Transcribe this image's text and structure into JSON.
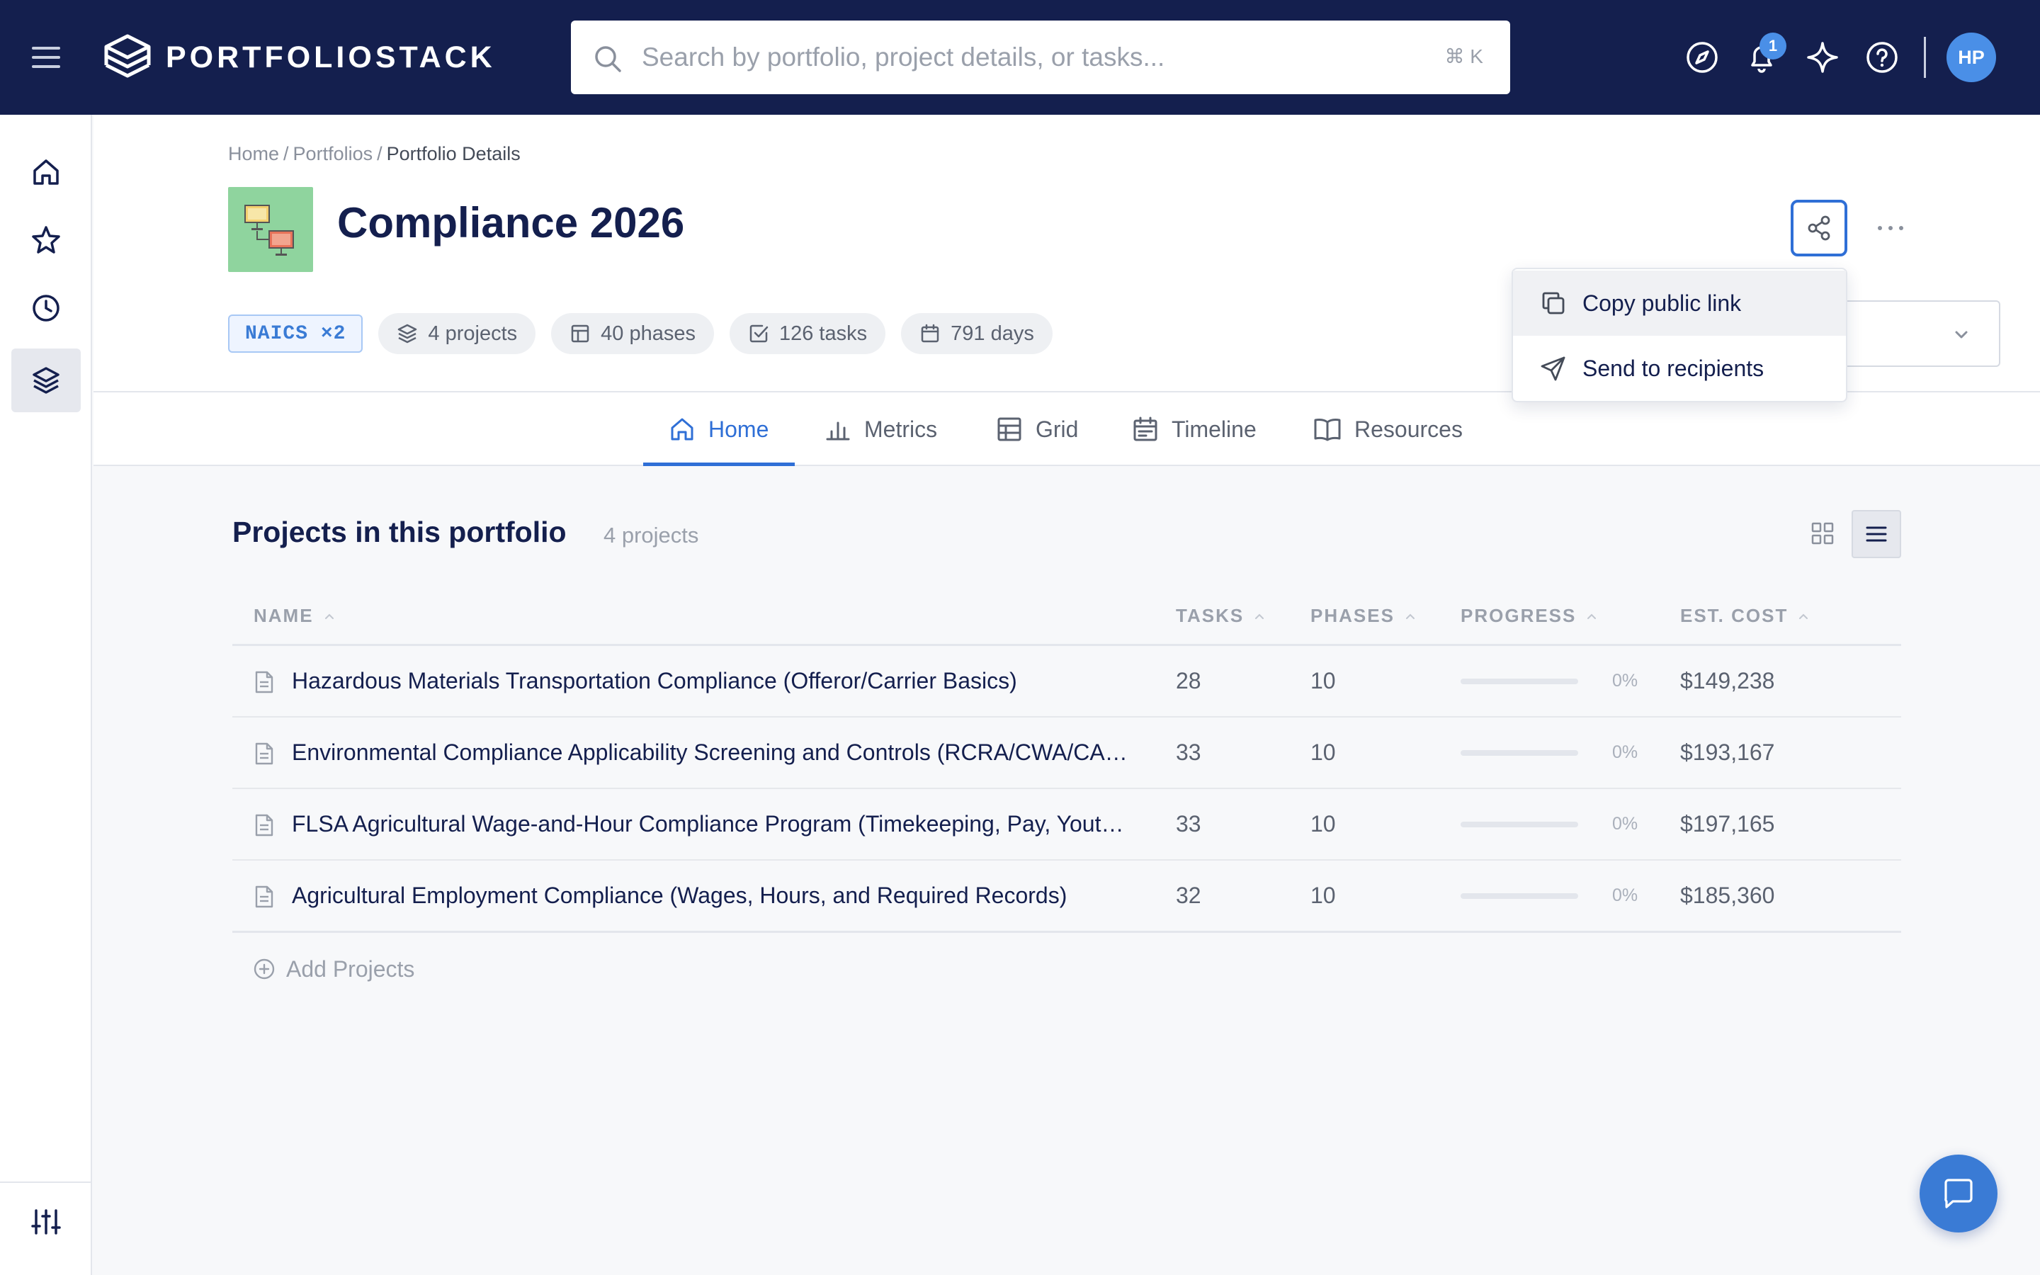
{
  "app": {
    "logo_text": "PORTFOLIOSTACK"
  },
  "search": {
    "placeholder": "Search by portfolio, project details, or tasks...",
    "shortcut": "⌘ K"
  },
  "topbar": {
    "notification_count": "1",
    "user_initials": "HP"
  },
  "breadcrumb": {
    "home": "Home",
    "portfolios": "Portfolios",
    "current": "Portfolio Details",
    "sep": "/"
  },
  "portfolio": {
    "title": "Compliance 2026",
    "naics_tag": "NAICS ×2",
    "projects_pill": "4 projects",
    "phases_pill": "40 phases",
    "tasks_pill": "126 tasks",
    "days_pill": "791 days"
  },
  "share_menu": {
    "copy_link": "Copy public link",
    "send": "Send to recipients"
  },
  "tabs": [
    {
      "label": "Home",
      "active": true
    },
    {
      "label": "Metrics"
    },
    {
      "label": "Grid"
    },
    {
      "label": "Timeline"
    },
    {
      "label": "Resources"
    }
  ],
  "projects_section": {
    "title": "Projects in this portfolio",
    "count": "4 projects",
    "columns": {
      "name": "NAME",
      "tasks": "TASKS",
      "phases": "PHASES",
      "progress": "PROGRESS",
      "cost": "EST. COST"
    },
    "rows": [
      {
        "name": "Hazardous Materials Transportation Compliance (Offeror/Carrier Basics)",
        "tasks": "28",
        "phases": "10",
        "progress": 0,
        "progress_label": "0%",
        "cost": "$149,238"
      },
      {
        "name": "Environmental Compliance Applicability Screening and Controls (RCRA/CWA/CA…",
        "tasks": "33",
        "phases": "10",
        "progress": 0,
        "progress_label": "0%",
        "cost": "$193,167"
      },
      {
        "name": "FLSA Agricultural Wage-and-Hour Compliance Program (Timekeeping, Pay, Yout…",
        "tasks": "33",
        "phases": "10",
        "progress": 0,
        "progress_label": "0%",
        "cost": "$197,165"
      },
      {
        "name": "Agricultural Employment Compliance (Wages, Hours, and Required Records)",
        "tasks": "32",
        "phases": "10",
        "progress": 0,
        "progress_label": "0%",
        "cost": "$185,360"
      }
    ],
    "add_label": "Add Projects"
  },
  "colors": {
    "navy": "#141f4e",
    "accent": "#2f6fd6",
    "badge": "#4a8fe7",
    "thumb": "#8fd49e"
  },
  "icons": [
    "menu-icon",
    "logo-icon",
    "search-icon",
    "compass-icon",
    "bell-icon",
    "sparkle-icon",
    "help-icon",
    "home-icon",
    "star-icon",
    "clock-icon",
    "layers-icon",
    "sliders-icon",
    "share-icon",
    "more-icon",
    "copy-icon",
    "send-icon",
    "chart-icon",
    "grid-icon",
    "calendar-icon",
    "book-icon",
    "document-icon",
    "plus-circle-icon",
    "chat-icon"
  ]
}
